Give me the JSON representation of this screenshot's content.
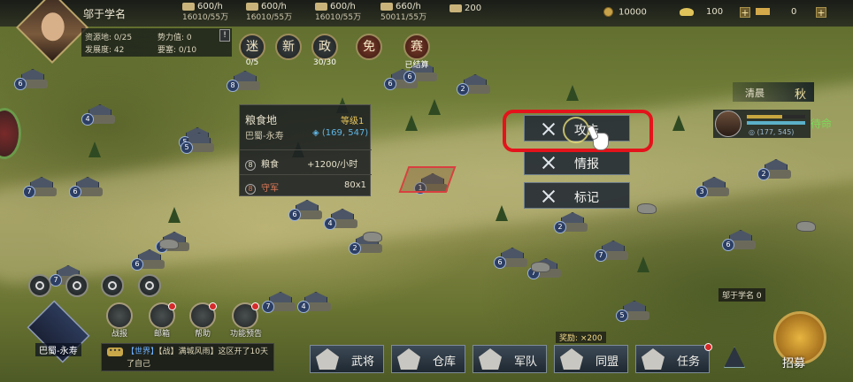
{
  "player": {
    "name": "邬于学名"
  },
  "resources": [
    {
      "icon": "wood-icon",
      "rate": "600/h",
      "amount": "16010/55万"
    },
    {
      "icon": "iron-icon",
      "rate": "600/h",
      "amount": "16010/55万"
    },
    {
      "icon": "stone-icon",
      "rate": "600/h",
      "amount": "16010/55万"
    },
    {
      "icon": "grain-icon",
      "rate": "660/h",
      "amount": "50011/55万"
    },
    {
      "icon": "order-icon",
      "rate": "200"
    }
  ],
  "currency": {
    "copper": "10000",
    "gold": "100",
    "jade": "0"
  },
  "stats": {
    "res_land": "资源地: 0/25",
    "influence": "势力值: 0",
    "development": "发展度: 42",
    "fortress": "要塞:   0/10"
  },
  "round_buttons": [
    {
      "label": "迷",
      "sub": "0/5"
    },
    {
      "label": "新",
      "sub": ""
    },
    {
      "label": "政",
      "sub": "30/30"
    },
    {
      "label": "免",
      "sub": ""
    },
    {
      "label": "赛",
      "sub": "已结算"
    }
  ],
  "tile_info": {
    "title": "粮食地",
    "level": "等级1",
    "location": "巴蜀-永寿",
    "coord": "(169, 547)",
    "rows": [
      {
        "badge": "8",
        "label": "粮食",
        "value": "+1200/小时"
      },
      {
        "badge": "8",
        "label": "守军",
        "value": "80x1"
      }
    ]
  },
  "actions": {
    "attack": "攻击",
    "intel": "情报",
    "mark": "标记"
  },
  "time": {
    "period": "清晨",
    "season": "秋"
  },
  "general": {
    "coord": "(177, 545)",
    "status": "待命",
    "stamina_fraction": 0.6
  },
  "tools": [
    "shield-map-icon",
    "search-icon",
    "location-pin-icon",
    "horse-icon"
  ],
  "bottom_left": [
    {
      "label": "战报",
      "icon": "battle-report-icon",
      "alert": false
    },
    {
      "label": "邮箱",
      "icon": "mail-icon",
      "alert": true
    },
    {
      "label": "帮助",
      "icon": "help-icon",
      "alert": true
    },
    {
      "label": "功能预告",
      "icon": "preview-icon",
      "alert": true
    }
  ],
  "city": {
    "name": "巴蜀-永寿"
  },
  "chat": {
    "channel": "【世界】",
    "msg": "【战】满城风雨】这区开了10天了自己"
  },
  "bottom_bar": [
    {
      "label": "武将",
      "icon": "general-icon"
    },
    {
      "label": "仓库",
      "icon": "warehouse-icon"
    },
    {
      "label": "军队",
      "icon": "army-icon"
    },
    {
      "label": "同盟",
      "icon": "alliance-icon"
    },
    {
      "label": "任务",
      "icon": "quest-icon"
    }
  ],
  "reward": "奖励: ×200",
  "recruit": {
    "label": "招募",
    "owner": "邬于学名",
    "badge": "0"
  },
  "map_levels": [
    "6",
    "4",
    "8",
    "6",
    "5",
    "7",
    "6",
    "5",
    "6",
    "6",
    "2",
    "7",
    "6",
    "5",
    "4",
    "6",
    "7",
    "2",
    "7",
    "6",
    "2",
    "7",
    "4",
    "5",
    "3",
    "2",
    "1"
  ]
}
